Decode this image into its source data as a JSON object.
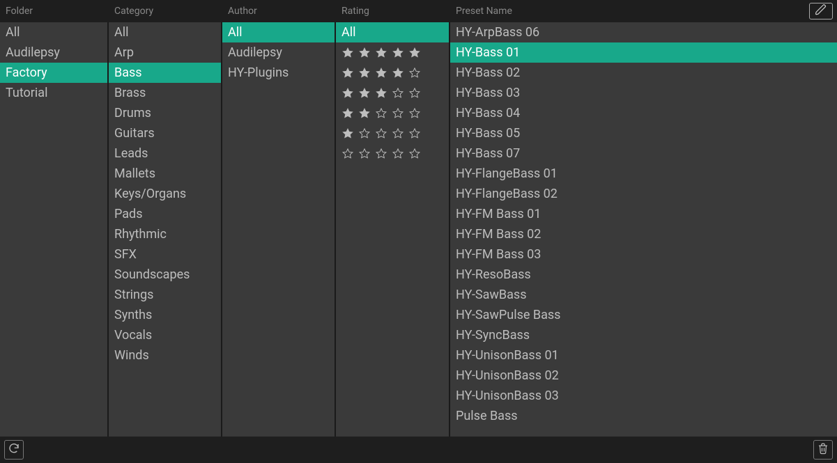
{
  "colors": {
    "accent": "#18a88a",
    "bg": "#1a1a1a",
    "panel": "#3a3a3a",
    "text": "#bdbdbd"
  },
  "columns": {
    "folder": {
      "header": "Folder",
      "items": [
        {
          "label": "All"
        },
        {
          "label": "Audilepsy"
        },
        {
          "label": "Factory",
          "selected": true
        },
        {
          "label": "Tutorial"
        }
      ]
    },
    "category": {
      "header": "Category",
      "items": [
        {
          "label": "All"
        },
        {
          "label": "Arp"
        },
        {
          "label": "Bass",
          "selected": true
        },
        {
          "label": "Brass"
        },
        {
          "label": "Drums"
        },
        {
          "label": "Guitars"
        },
        {
          "label": "Leads"
        },
        {
          "label": "Mallets"
        },
        {
          "label": "Keys/Organs"
        },
        {
          "label": "Pads"
        },
        {
          "label": "Rhythmic"
        },
        {
          "label": "SFX"
        },
        {
          "label": "Soundscapes"
        },
        {
          "label": "Strings"
        },
        {
          "label": "Synths"
        },
        {
          "label": "Vocals"
        },
        {
          "label": "Winds"
        }
      ]
    },
    "author": {
      "header": "Author",
      "items": [
        {
          "label": "All",
          "selected": true
        },
        {
          "label": "Audilepsy"
        },
        {
          "label": "HY-Plugins"
        }
      ]
    },
    "rating": {
      "header": "Rating",
      "items": [
        {
          "label": "All",
          "selected": true
        },
        {
          "stars": 5
        },
        {
          "stars": 4
        },
        {
          "stars": 3
        },
        {
          "stars": 2
        },
        {
          "stars": 1
        },
        {
          "stars": 0
        }
      ]
    },
    "preset": {
      "header": "Preset Name",
      "items": [
        {
          "label": "HY-ArpBass 06"
        },
        {
          "label": "HY-Bass 01",
          "selected": true
        },
        {
          "label": "HY-Bass 02"
        },
        {
          "label": "HY-Bass 03"
        },
        {
          "label": "HY-Bass 04"
        },
        {
          "label": "HY-Bass 05"
        },
        {
          "label": "HY-Bass 07"
        },
        {
          "label": "HY-FlangeBass 01"
        },
        {
          "label": "HY-FlangeBass 02"
        },
        {
          "label": "HY-FM Bass 01"
        },
        {
          "label": "HY-FM Bass 02"
        },
        {
          "label": "HY-FM Bass 03"
        },
        {
          "label": "HY-ResoBass"
        },
        {
          "label": "HY-SawBass"
        },
        {
          "label": "HY-SawPulse Bass"
        },
        {
          "label": "HY-SyncBass"
        },
        {
          "label": "HY-UnisonBass 01"
        },
        {
          "label": "HY-UnisonBass 02"
        },
        {
          "label": "HY-UnisonBass 03"
        },
        {
          "label": "Pulse Bass"
        }
      ]
    }
  },
  "icons": {
    "edit": "pencil-icon",
    "refresh": "refresh-icon",
    "trash": "trash-icon"
  }
}
